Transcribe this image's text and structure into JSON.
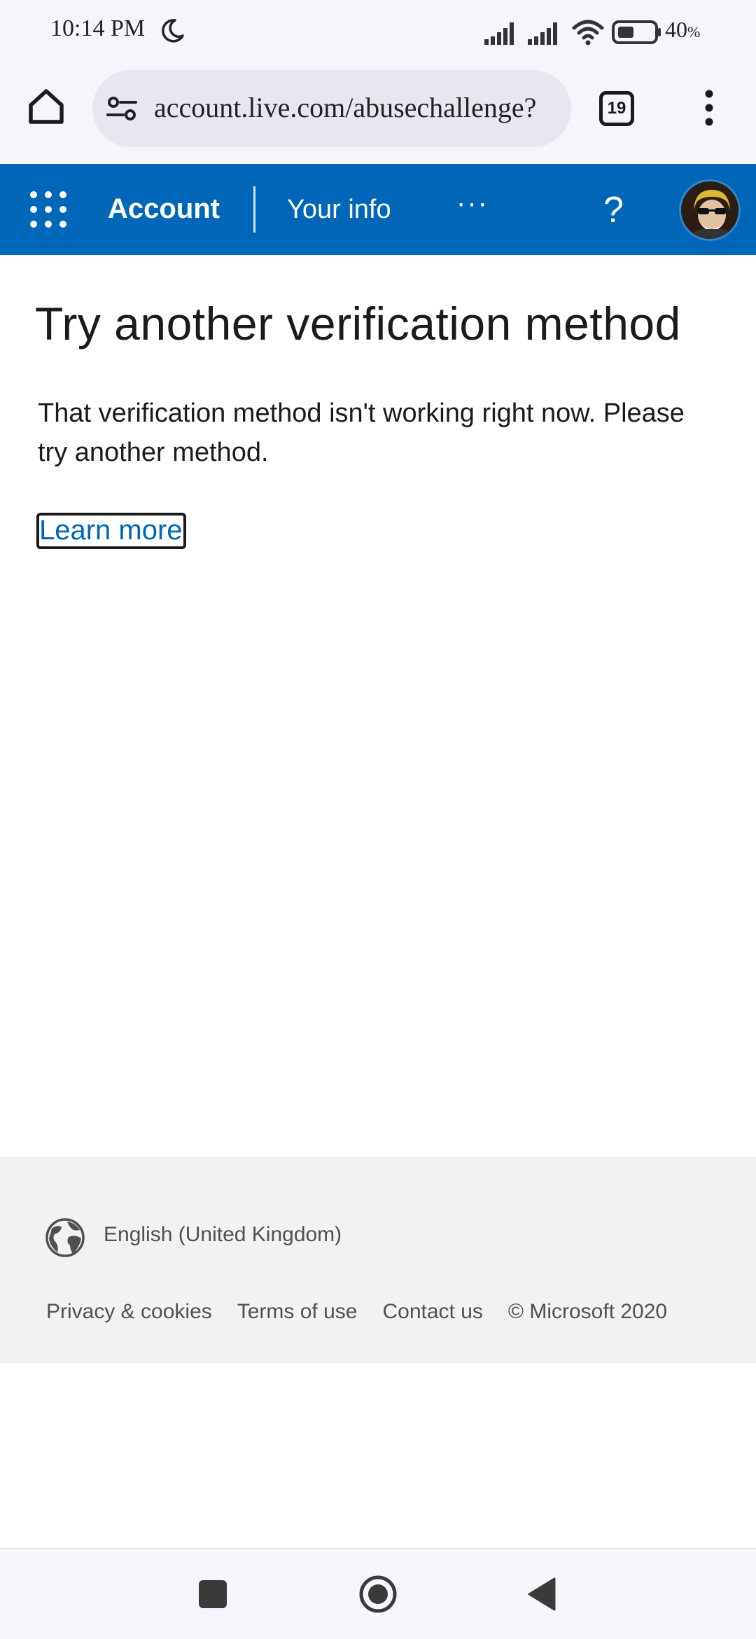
{
  "status_bar": {
    "time": "10:14 PM",
    "battery_value": "40",
    "battery_unit": "%",
    "icons": [
      "moon-icon",
      "signal-icon",
      "signal-icon",
      "wifi-icon",
      "battery-icon"
    ]
  },
  "browser": {
    "url": "account.live.com/abusechallenge?",
    "tab_count": "19",
    "icons": [
      "home-icon",
      "tune-icon",
      "more-vert-icon"
    ]
  },
  "header": {
    "brand": "Account",
    "nav_item": "Your info",
    "more": "···",
    "help": "?",
    "accent_color": "#0067b8"
  },
  "main": {
    "title": "Try another verification method",
    "description": "That verification method isn't working right now. Please try another method.",
    "learn_more": "Learn more",
    "link_color": "#0067b8"
  },
  "footer": {
    "language": "English (United Kingdom)",
    "links": [
      "Privacy & cookies",
      "Terms of use",
      "Contact us",
      "© Microsoft 2020"
    ]
  },
  "nav": {
    "icons": [
      "recents-square-icon",
      "home-circle-icon",
      "back-triangle-icon"
    ]
  }
}
